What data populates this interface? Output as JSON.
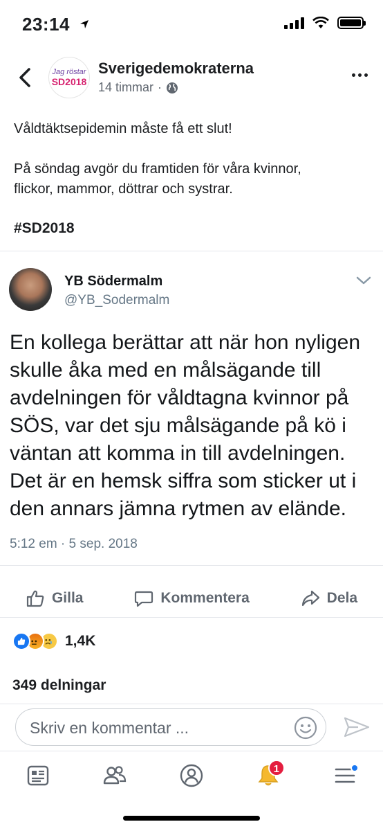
{
  "status_bar": {
    "time": "23:14"
  },
  "post": {
    "page_name": "Sverigedemokraterna",
    "avatar_line1": "Jag röstar",
    "avatar_line2": "SD2018",
    "time_ago": "14 timmar",
    "paragraph1": "Våldtäktsepidemin måste få ett slut!",
    "paragraph2": "På söndag avgör du framtiden för våra kvinnor,\nflickor, mammor, döttrar och systrar.",
    "hashtag": "#SD2018"
  },
  "tweet": {
    "name": "YB Södermalm",
    "handle": "@YB_Sodermalm",
    "body": "En kollega berättar att när hon nyligen\nskulle åka med en målsägande till\navdelningen för våldtagna kvinnor på\nSÖS, var det sju målsägande på kö i\nväntan att komma in till avdelningen.\nDet är en hemsk siffra som sticker ut i\nden annars jämna rytmen av elände.",
    "date": "5:12 em · 5 sep. 2018"
  },
  "actions": {
    "like": "Gilla",
    "comment": "Kommentera",
    "share": "Dela"
  },
  "reactions": {
    "count": "1,4K",
    "types": [
      "like",
      "angry",
      "sad"
    ]
  },
  "shares": "349 delningar",
  "comment_bar": {
    "placeholder": "Skriv en kommentar ..."
  },
  "bottom_nav": {
    "items": [
      "news-feed",
      "friends",
      "profile",
      "notifications",
      "menu"
    ],
    "notification_badge": "1"
  },
  "colors": {
    "accent": "#1877f2",
    "badge": "#e41e3f",
    "muted_text": "#606770"
  }
}
